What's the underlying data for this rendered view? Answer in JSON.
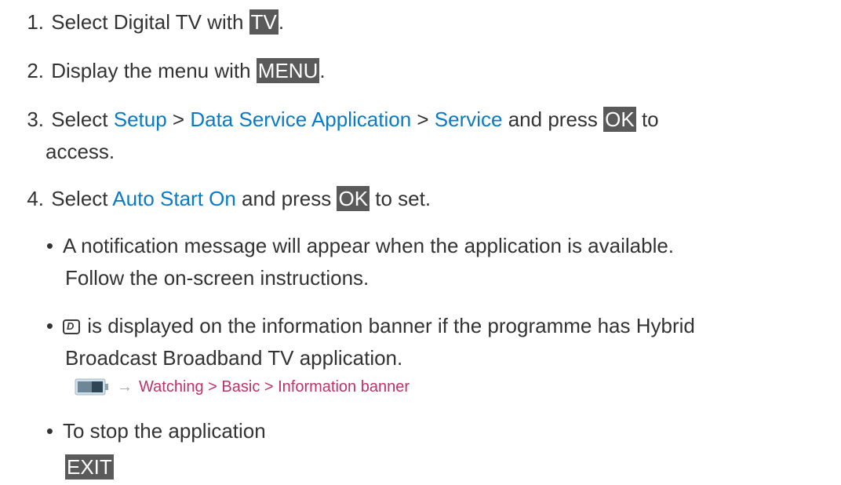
{
  "steps": [
    {
      "num": "1.",
      "text_before": "Select Digital TV with ",
      "key": "TV",
      "text_after": "."
    },
    {
      "num": "2.",
      "text_before": "Display the menu with ",
      "key": "MENU",
      "text_after": "."
    },
    {
      "num": "3.",
      "text_a": "Select ",
      "link1": "Setup",
      "sep1": " > ",
      "link2": "Data Service Application",
      "sep2": " > ",
      "link3": "Service",
      "text_b": " and press ",
      "key": "OK",
      "text_c": " to",
      "line2": "access."
    },
    {
      "num": "4.",
      "text_a": "Select ",
      "link1": "Auto Start On",
      "text_b": " and press ",
      "key": "OK",
      "text_c": " to set."
    }
  ],
  "bullets": [
    {
      "line1": "A notification message will appear when the application is available.",
      "line2": "Follow the on-screen instructions."
    },
    {
      "icon": "hybrid-broadcast-d-icon",
      "line1_rest": " is displayed on the information banner if the programme has Hybrid",
      "line2": "Broadcast Broadband TV application."
    },
    {
      "line1": "To stop the application",
      "key": "EXIT"
    }
  ],
  "reference": {
    "icon": "tv-monitor-icon",
    "arrow": "→",
    "path": "Watching > Basic > Information banner"
  },
  "colors": {
    "link": "#0a7ac4",
    "reference": "#c0306a",
    "key_bg": "#5a5a5a"
  }
}
